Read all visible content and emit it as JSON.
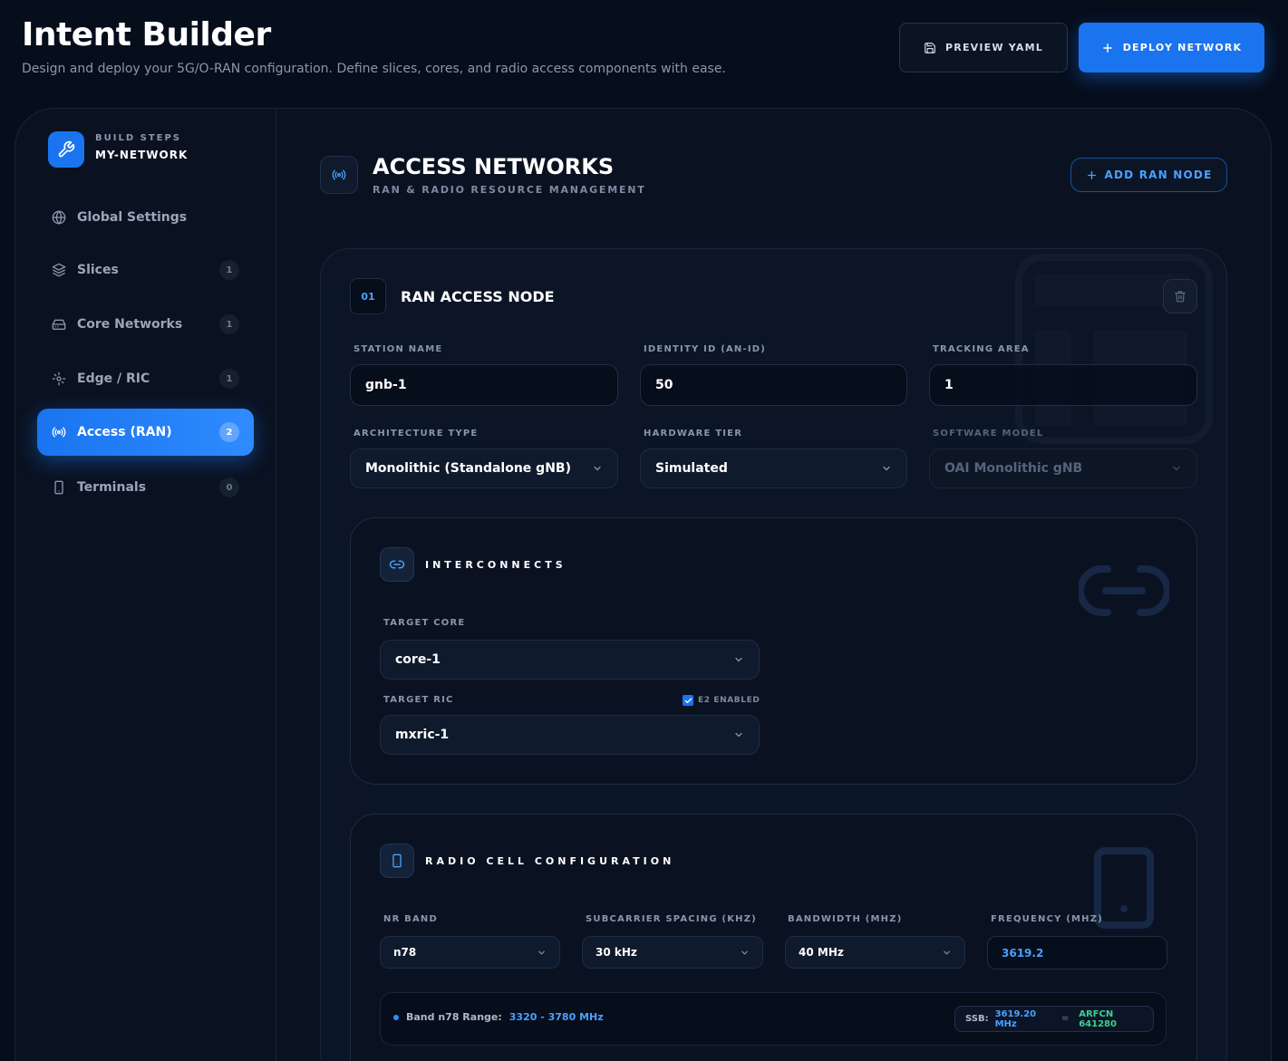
{
  "header": {
    "title": "Intent Builder",
    "subtitle": "Design and deploy your 5G/O-RAN configuration. Define slices, cores, and radio access components with ease.",
    "preview_label": "PREVIEW YAML",
    "deploy_label": "DEPLOY NETWORK"
  },
  "sidebar": {
    "kicker": "BUILD STEPS",
    "network_name": "MY-NETWORK",
    "items": [
      {
        "label": "Global Settings",
        "icon": "globe-icon",
        "count": null
      },
      {
        "label": "Slices",
        "icon": "layers-icon",
        "count": "1"
      },
      {
        "label": "Core Networks",
        "icon": "server-icon",
        "count": "1"
      },
      {
        "label": "Edge / RIC",
        "icon": "edge-icon",
        "count": "1"
      },
      {
        "label": "Access (RAN)",
        "icon": "antenna-icon",
        "count": "2",
        "active": true
      },
      {
        "label": "Terminals",
        "icon": "phone-icon",
        "count": "0"
      }
    ]
  },
  "section": {
    "title": "ACCESS NETWORKS",
    "subtitle": "RAN & RADIO RESOURCE MANAGEMENT",
    "add_label": "ADD RAN NODE"
  },
  "node": {
    "number": "01",
    "title": "RAN ACCESS NODE",
    "fields": {
      "station_name": {
        "label": "STATION NAME",
        "value": "gnb-1"
      },
      "identity_id": {
        "label": "IDENTITY ID (AN-ID)",
        "value": "50"
      },
      "tracking_area": {
        "label": "TRACKING AREA",
        "value": "1"
      },
      "architecture": {
        "label": "ARCHITECTURE TYPE",
        "value": "Monolithic (Standalone gNB)"
      },
      "hardware_tier": {
        "label": "HARDWARE TIER",
        "value": "Simulated"
      },
      "software_model": {
        "label": "SOFTWARE MODEL",
        "value": "OAI Monolithic gNB",
        "disabled": true
      }
    }
  },
  "interconnects": {
    "title": "INTERCONNECTS",
    "target_core_label": "TARGET CORE",
    "target_core_value": "core-1",
    "target_ric_label": "TARGET RIC",
    "target_ric_value": "mxric-1",
    "e2_label": "E2 ENABLED",
    "e2_enabled": true
  },
  "radio": {
    "title": "RADIO CELL CONFIGURATION",
    "nr_band": {
      "label": "NR BAND",
      "value": "n78"
    },
    "scs": {
      "label": "SUBCARRIER SPACING (KHZ)",
      "value": "30 kHz"
    },
    "bandwidth": {
      "label": "BANDWIDTH (MHZ)",
      "value": "40 MHz"
    },
    "frequency": {
      "label": "FREQUENCY (MHZ)",
      "value": "3619.2"
    },
    "band_range_label": "Band n78 Range:",
    "band_range_value": "3320 - 3780 MHz",
    "ssb_label": "SSB:",
    "ssb_value": "3619.20 MHz",
    "equals": "=",
    "arfcn": "ARFCN 641280"
  },
  "colors": {
    "accent": "#1a74ef",
    "accent_text": "#4aa1ff",
    "arfcn_green": "#3ecf8e",
    "background": "#060d1b"
  }
}
